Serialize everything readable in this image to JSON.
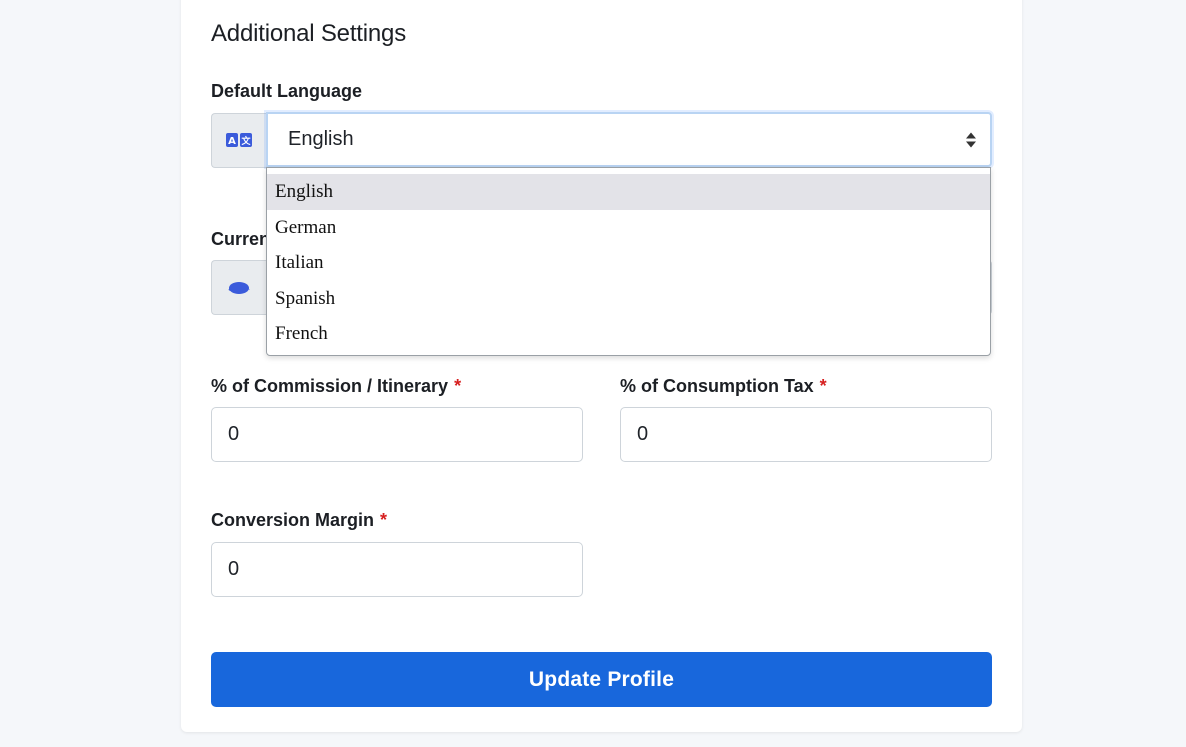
{
  "section": {
    "title": "Additional Settings"
  },
  "language": {
    "label": "Default Language",
    "selected": "English",
    "options": [
      "English",
      "German",
      "Italian",
      "Spanish",
      "French"
    ],
    "icon": "translate-icon"
  },
  "currency": {
    "label_partial": "Curren",
    "icon": "coin-icon"
  },
  "commission": {
    "label": "% of Commission / Itinerary",
    "required_mark": "*",
    "value": "0"
  },
  "tax": {
    "label": "% of Consumption Tax",
    "required_mark": "*",
    "value": "0"
  },
  "margin": {
    "label": "Conversion Margin",
    "required_mark": "*",
    "value": "0"
  },
  "actions": {
    "update_label": "Update Profile"
  },
  "colors": {
    "primary": "#1867dc",
    "required": "#d61f1f",
    "icon": "#3b5bdb"
  }
}
